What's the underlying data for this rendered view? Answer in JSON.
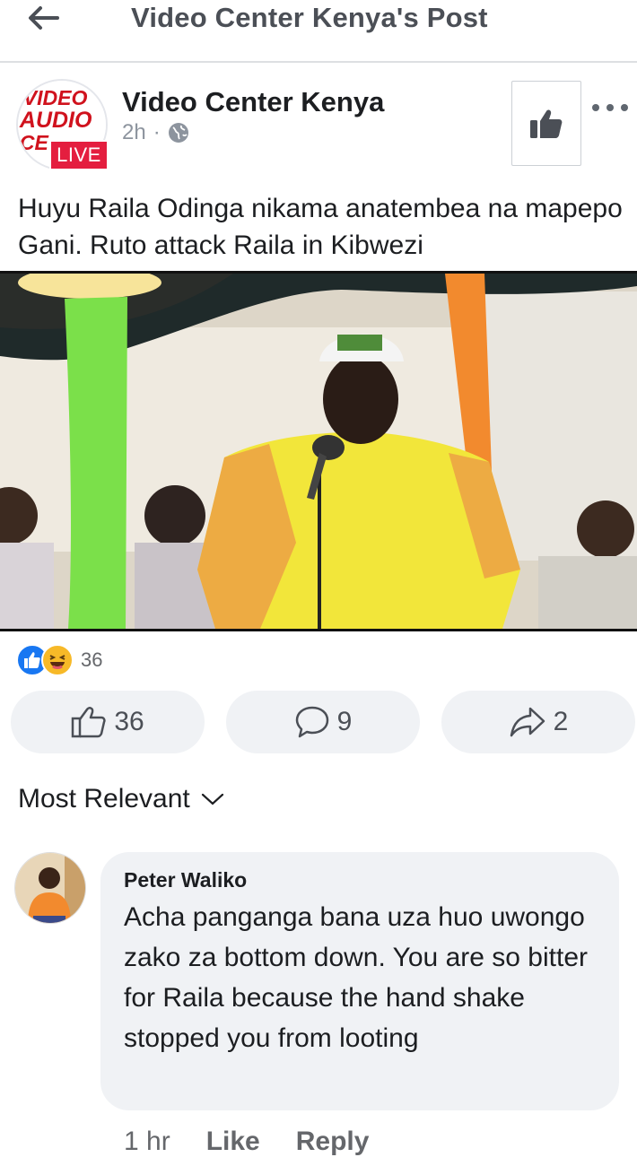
{
  "header": {
    "title": "Video Center Kenya's Post"
  },
  "post": {
    "page_name": "Video Center Kenya",
    "time": "2h",
    "live_badge": "LIVE",
    "text": "Huyu Raila Odinga nikama anatembea na mapepo Gani. Ruto attack Raila in Kibwezi",
    "logo_text": [
      "VIDEO",
      "AUDIO",
      "CE"
    ]
  },
  "reactions": {
    "count": "36"
  },
  "actions": {
    "likes": "36",
    "comments": "9",
    "shares": "2"
  },
  "sort": {
    "label": "Most Relevant"
  },
  "comment": {
    "author": "Peter Waliko",
    "text": "Acha panganga bana uza huo uwongo zako za bottom down. You are so bitter for Raila because the hand shake stopped you from looting",
    "time": "1 hr",
    "like_label": "Like",
    "reply_label": "Reply"
  },
  "colors": {
    "live": "#e41e3f",
    "like_blue": "#1877f2",
    "haha_yellow": "#f7b928"
  }
}
